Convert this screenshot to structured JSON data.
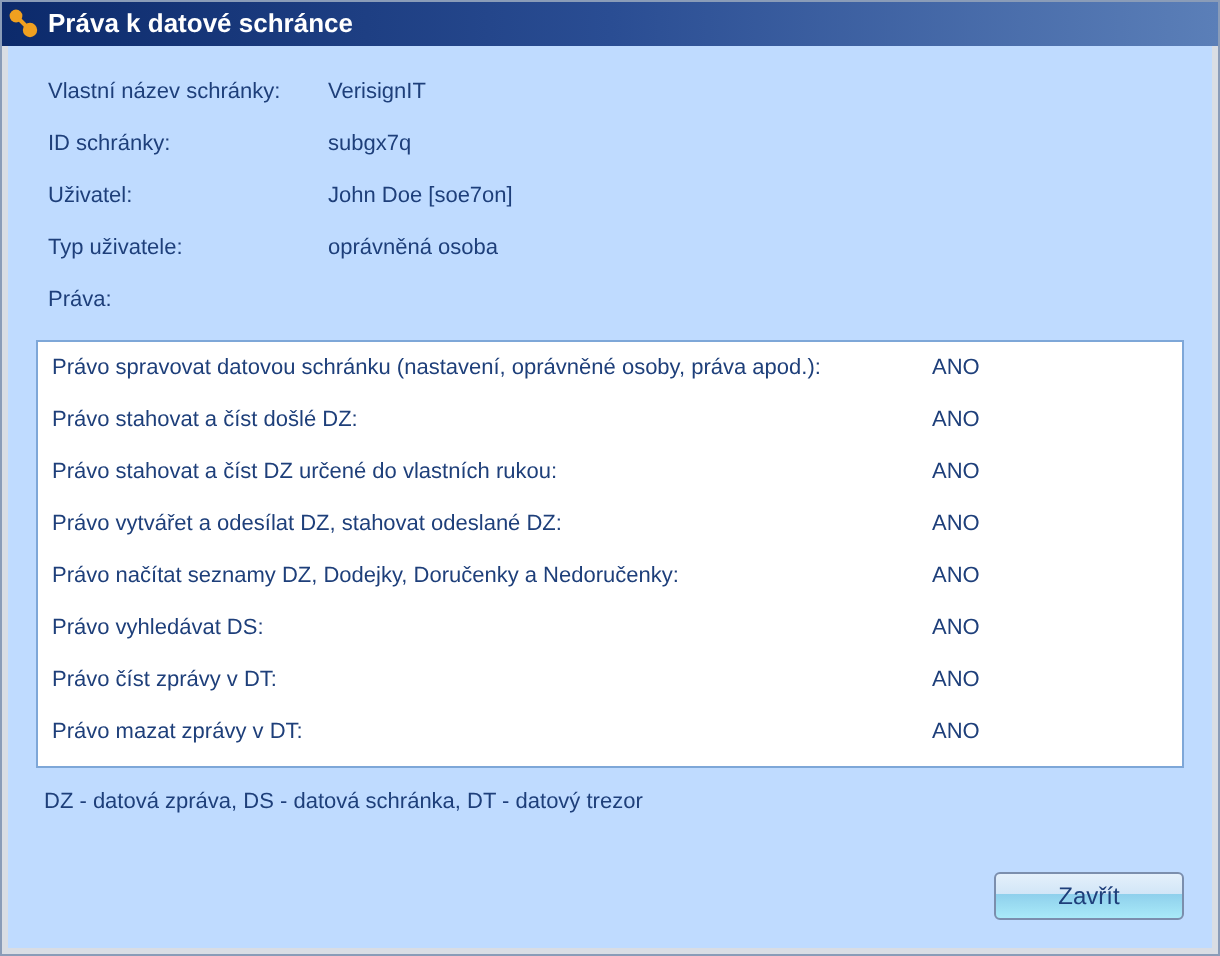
{
  "window": {
    "title": "Práva k datové schránce"
  },
  "fields": [
    {
      "label": "Vlastní název schránky:",
      "value": "VerisignIT"
    },
    {
      "label": "ID schránky:",
      "value": "subgx7q"
    },
    {
      "label": "Uživatel:",
      "value": "John Doe [soe7on]"
    },
    {
      "label": "Typ uživatele:",
      "value": "oprávněná osoba"
    }
  ],
  "rights_label": "Práva:",
  "rights": [
    {
      "name": "Právo spravovat datovou schránku (nastavení, oprávněné osoby, práva apod.):",
      "value": "ANO"
    },
    {
      "name": "Právo stahovat a číst došlé DZ:",
      "value": "ANO"
    },
    {
      "name": "Právo stahovat a číst DZ určené do vlastních rukou:",
      "value": "ANO"
    },
    {
      "name": "Právo vytvářet a odesílat DZ, stahovat odeslané DZ:",
      "value": "ANO"
    },
    {
      "name": "Právo načítat seznamy DZ, Dodejky, Doručenky a Nedoručenky:",
      "value": "ANO"
    },
    {
      "name": "Právo vyhledávat DS:",
      "value": "ANO"
    },
    {
      "name": "Právo číst zprávy v DT:",
      "value": "ANO"
    },
    {
      "name": "Právo mazat zprávy v DT:",
      "value": "ANO"
    }
  ],
  "legend": "DZ - datová zpráva, DS - datová schránka, DT - datový trezor",
  "buttons": [
    "Zavřít"
  ]
}
